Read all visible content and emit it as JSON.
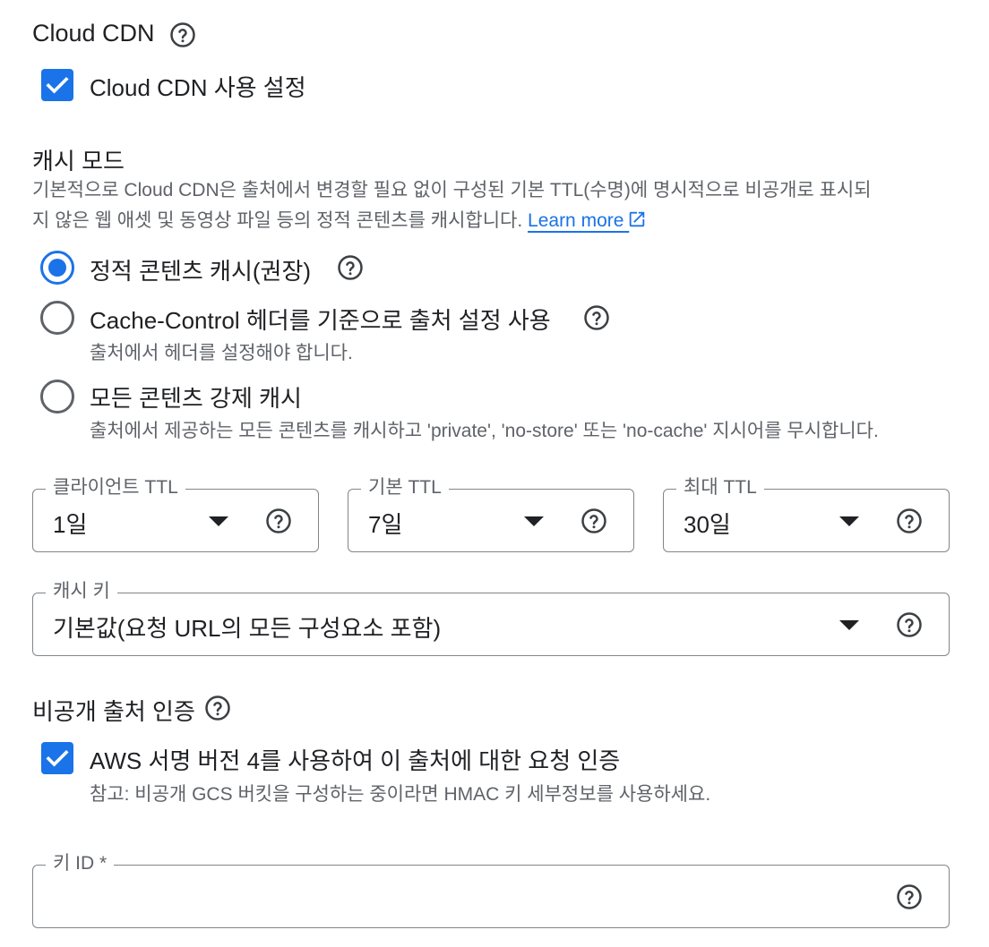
{
  "cdn": {
    "title": "Cloud CDN",
    "enable_label": "Cloud CDN 사용 설정",
    "enable_checked": true
  },
  "cache_mode": {
    "title": "캐시 모드",
    "description_line1": "기본적으로 Cloud CDN은 출처에서 변경할 필요 없이 구성된 기본 TTL(수명)에 명시적으로 비공개로 표시되",
    "description_line2": "지 않은 웹 애셋 및 동영상 파일 등의 정적 콘텐츠를 캐시합니다.",
    "learn_more": "Learn more",
    "options": [
      {
        "label": "정적 콘텐츠 캐시(권장)",
        "selected": true,
        "sub": ""
      },
      {
        "label": "Cache-Control 헤더를 기준으로 출처 설정 사용",
        "selected": false,
        "sub": "출처에서 헤더를 설정해야 합니다."
      },
      {
        "label": "모든 콘텐츠 강제 캐시",
        "selected": false,
        "sub": "출처에서 제공하는 모든 콘텐츠를 캐시하고 'private', 'no-store' 또는 'no-cache' 지시어를 무시합니다."
      }
    ]
  },
  "ttl": {
    "client": {
      "label": "클라이언트 TTL",
      "value": "1일"
    },
    "default": {
      "label": "기본 TTL",
      "value": "7일"
    },
    "max": {
      "label": "최대 TTL",
      "value": "30일"
    }
  },
  "cache_key": {
    "label": "캐시 키",
    "value": "기본값(요청 URL의 모든 구성요소 포함)"
  },
  "private_origin": {
    "title": "비공개 출처 인증",
    "aws_label": "AWS 서명 버전 4를 사용하여 이 출처에 대한 요청 인증",
    "aws_checked": true,
    "aws_note": "참고: 비공개 GCS 버킷을 구성하는 중이라면 HMAC 키 세부정보를 사용하세요."
  },
  "key_id": {
    "label": "키 ID *",
    "value": ""
  },
  "colors": {
    "accent": "#1a73e8",
    "text": "#202124",
    "secondary": "#5f6368",
    "border": "#80868b"
  },
  "icons": {
    "help": "help-circle-icon",
    "check": "check-icon",
    "external": "external-link-icon",
    "dropdown": "arrow-drop-down-icon"
  }
}
